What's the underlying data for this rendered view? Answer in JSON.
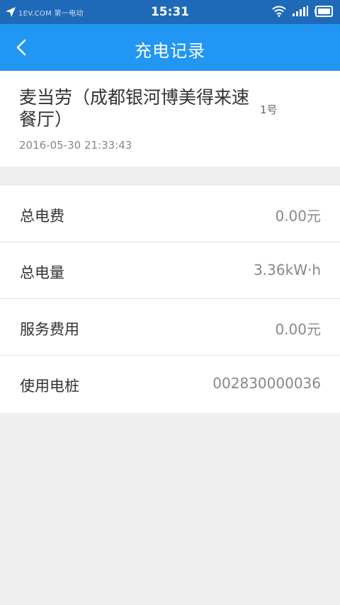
{
  "status_bar": {
    "watermark": "1EV.COM 第一电动",
    "time": "15:31",
    "icons": [
      "location-arrow-icon",
      "wifi-icon",
      "signal-icon",
      "battery-icon"
    ]
  },
  "header": {
    "title": "充电记录",
    "back_icon": "back-chevron-icon"
  },
  "station": {
    "name": "麦当劳（成都银河博美得来速餐厅）",
    "plug": "1号",
    "datetime": "2016-05-30 21:33:43"
  },
  "details": {
    "rows": [
      {
        "label": "总电费",
        "value": "0.00元"
      },
      {
        "label": "总电量",
        "value": "3.36kW·h"
      },
      {
        "label": "服务费用",
        "value": "0.00元"
      },
      {
        "label": "使用电桩",
        "value": "002830000036"
      }
    ]
  },
  "colors": {
    "header": "#2196f3",
    "status_bar": "#1f6ab8",
    "background": "#efefef"
  }
}
